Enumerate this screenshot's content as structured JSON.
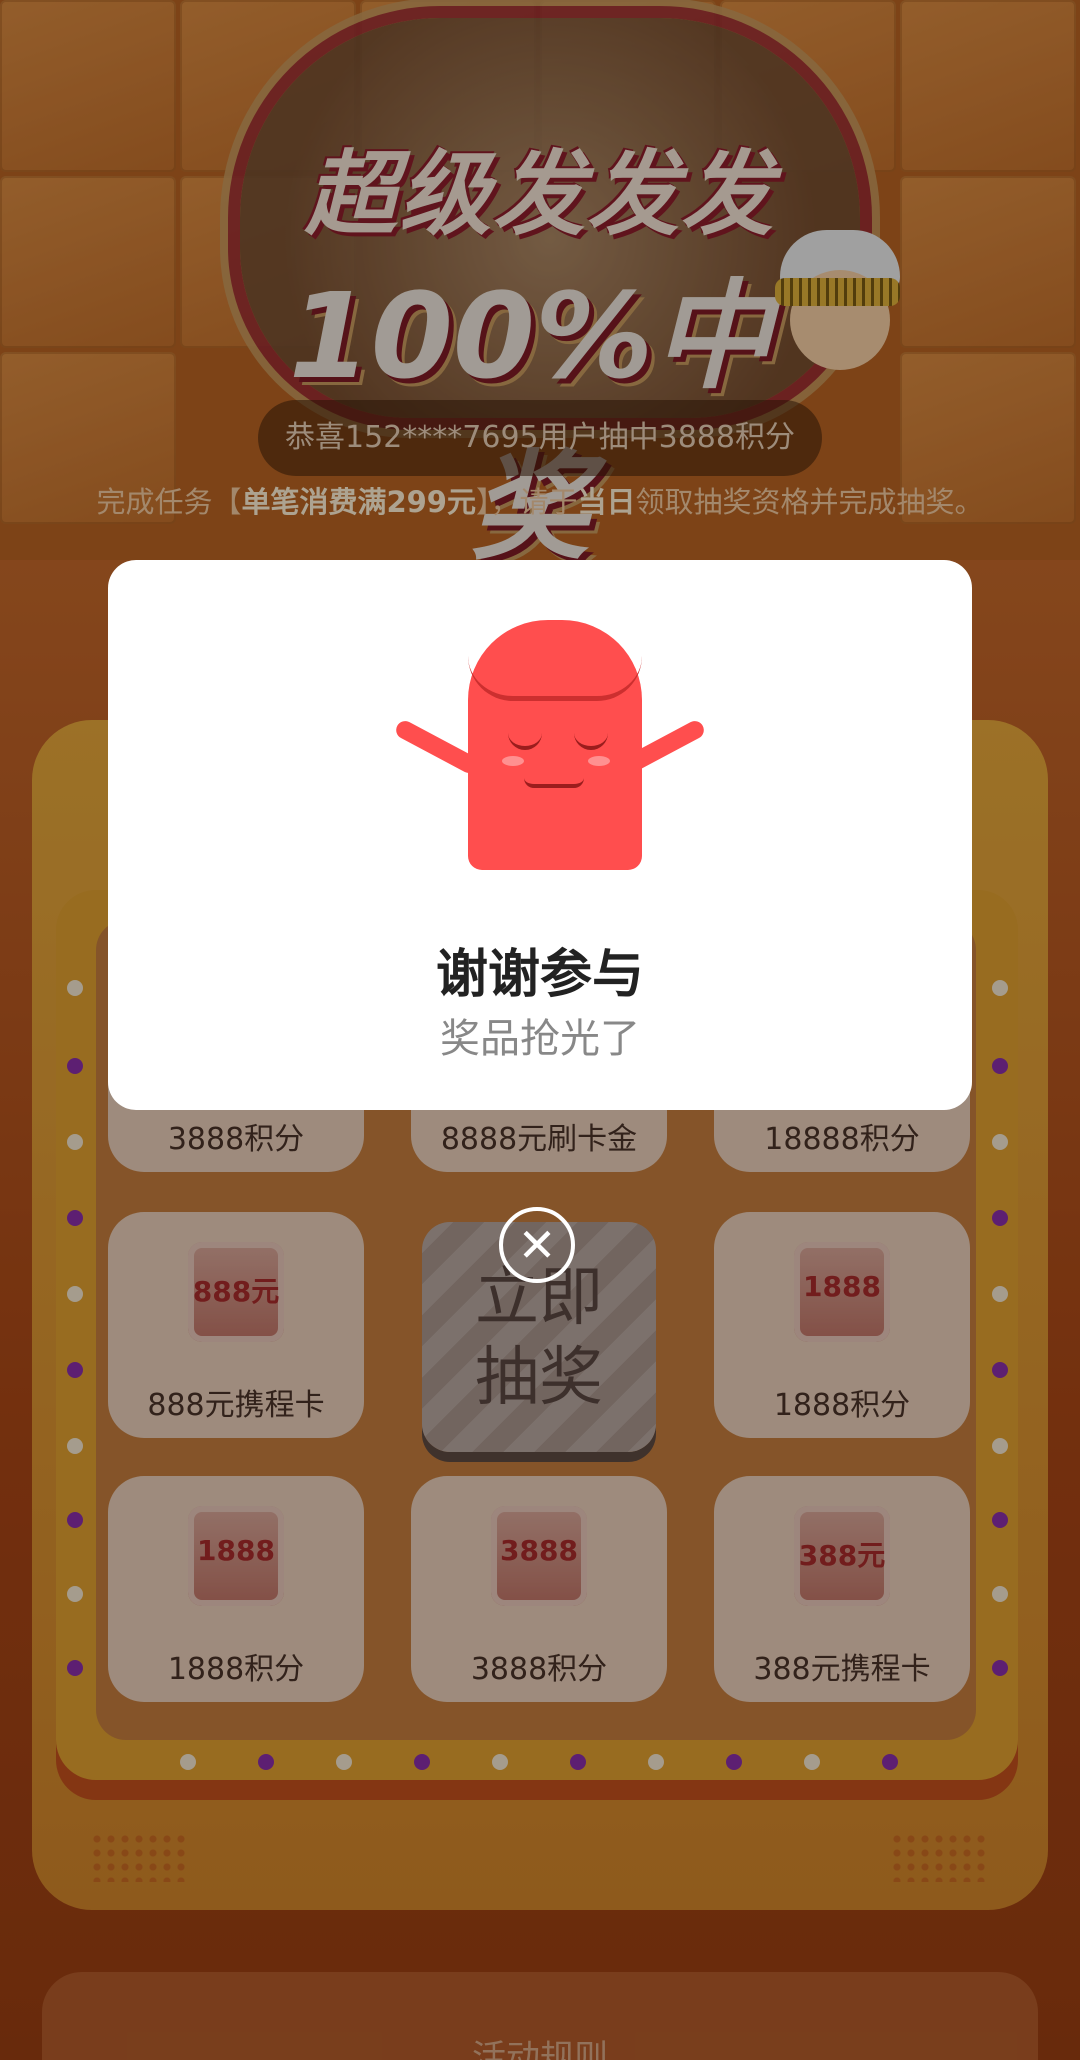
{
  "header": {
    "title_line1": "超级发发发",
    "title_line2": "100%中奖",
    "winner_notice": "恭喜152****7695用户抽中3888积分",
    "task_prefix": "完成任务【",
    "task_highlight": "单笔消费满299元",
    "task_middle": "】，请于",
    "task_day": "当日",
    "task_suffix": "领取抽奖资格并完成抽奖。"
  },
  "grid": {
    "top_row_labels": [
      "3888积分",
      "8888元刷卡金",
      "18888积分"
    ],
    "middle_left": {
      "badge": "888元",
      "label": "888元携程卡"
    },
    "draw_button": {
      "line1": "立即",
      "line2": "抽奖"
    },
    "middle_right": {
      "badge": "1888",
      "label": "1888积分"
    },
    "bottom_row": [
      {
        "badge": "1888",
        "label": "1888积分"
      },
      {
        "badge": "3888",
        "label": "3888积分"
      },
      {
        "badge": "388元",
        "label": "388元携程卡"
      }
    ]
  },
  "modal": {
    "title": "谢谢参与",
    "subtitle": "奖品抢光了",
    "close_symbol": "✕"
  },
  "rules": {
    "title": "活动规则"
  },
  "colors": {
    "accent": "#ff4e4e",
    "dot_purple": "#8a2fa8",
    "dot_light": "#f3e6d0"
  }
}
